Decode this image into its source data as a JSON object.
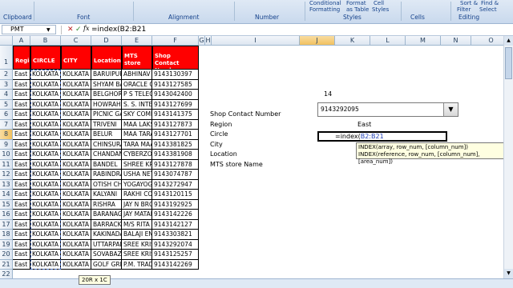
{
  "ribbon": {
    "top_labels": [
      "Formatting",
      "as Table",
      "Styles",
      "Filter",
      "Select"
    ],
    "top_label_extra": [
      "Conditional",
      "Format",
      "Cell",
      "Sort &",
      "Find &"
    ],
    "groups": [
      "Clipboard",
      "Font",
      "Alignment",
      "Number",
      "Styles",
      "Cells",
      "Editing"
    ]
  },
  "formula_bar": {
    "name_box": "PMT",
    "cancel_icon": "✕",
    "enter_icon": "✓",
    "fx_label": "fx",
    "formula": "=index(B2:B21"
  },
  "columns": [
    "A",
    "B",
    "C",
    "D",
    "E",
    "F",
    "G",
    "H",
    "I",
    "J",
    "K",
    "L",
    "M",
    "N",
    "O"
  ],
  "rows": [
    "1",
    "2",
    "3",
    "4",
    "5",
    "6",
    "7",
    "8",
    "9",
    "10",
    "11",
    "12",
    "13",
    "14",
    "15",
    "16",
    "17",
    "18",
    "19",
    "20",
    "21",
    "22"
  ],
  "table": {
    "headers": [
      "Region",
      "CIRCLE",
      "CITY",
      "Location",
      "MTS store name",
      "Shop Contact Number"
    ],
    "rows": [
      [
        "East",
        "KOLKATA",
        "KOLKATA SO",
        "BARUIPUR",
        "ABHINAV R",
        "9143130397"
      ],
      [
        "East",
        "KOLKATA",
        "KOLKATA CE",
        "SHYAM BAZ",
        "ORACLE CO",
        "9143127585"
      ],
      [
        "East",
        "KOLKATA",
        "KOLKATA NO",
        "BELGHORIA",
        "P S TELECO",
        "9143042400"
      ],
      [
        "East",
        "KOLKATA",
        "KOLKATA W",
        "HOWRAH",
        "S. S. INTER",
        "9143127699"
      ],
      [
        "East",
        "KOLKATA",
        "KOLKATA CE",
        "PICNIC GAR",
        "SKY COMM",
        "9143141375"
      ],
      [
        "East",
        "KOLKATA",
        "KOLKATA W",
        "TRIVENI",
        "MAA LAKSH",
        "9143127873"
      ],
      [
        "East",
        "KOLKATA",
        "KOLKATA W",
        "BELUR",
        "MAA TARA",
        "9143127701"
      ],
      [
        "East",
        "KOLKATA",
        "KOLKATA W",
        "CHINSURAH",
        "TARA MAA",
        "9143381825"
      ],
      [
        "East",
        "KOLKATA",
        "KOLKATA W",
        "CHANDANN",
        "CYBERZONE",
        "9143381908"
      ],
      [
        "East",
        "KOLKATA",
        "KOLKATA W",
        "BANDEL",
        "SHREE KRISH",
        "9143127878"
      ],
      [
        "East",
        "KOLKATA",
        "KOLKATA CE",
        "RABINDRA",
        "USHA NETCO",
        "9143074787"
      ],
      [
        "East",
        "KOLKATA",
        "KOLKATA SC",
        "OTISH CHA",
        "YOGAYOG",
        "9143272947"
      ],
      [
        "East",
        "KOLKATA",
        "KOLKATA NO",
        "KALYANI",
        "RAKHI COM",
        "9143120115"
      ],
      [
        "East",
        "KOLKATA",
        "KOLKATA W",
        "RISHRA",
        "JAY N BROT",
        "9143192925"
      ],
      [
        "East",
        "KOLKATA",
        "KOLKATA NO",
        "BARANAGAR",
        "JAY MATAD",
        "9143142226"
      ],
      [
        "East",
        "KOLKATA",
        "KOLKATA NO",
        "BARRACKPO",
        "M/S RITA TE",
        "9143142127"
      ],
      [
        "East",
        "KOLKATA",
        "KOLKATA NO",
        "KAKINADA",
        "BALAJI ENTE",
        "9143303821"
      ],
      [
        "East",
        "KOLKATA",
        "KOLKATA NO",
        "UTTARPARA",
        "SREE KRISH",
        "9143292074"
      ],
      [
        "East",
        "KOLKATA",
        "KOLKATA CE",
        "SOVABAZAR",
        "SREE KRISH",
        "9143125257"
      ],
      [
        "East",
        "KOLKATA",
        "KOLKATA SC",
        "GOLF GREE",
        "P.M. TRADI",
        "9143142269"
      ]
    ]
  },
  "right_panel": {
    "index_value": "14",
    "dropdown_value": "9143292095",
    "region_value": "East",
    "labels": [
      "Shop Contact Number",
      "Region",
      "Circle",
      "City",
      "Location",
      "MTS store Name"
    ],
    "edit_prefix": "=index(",
    "edit_ref": "B2:B21"
  },
  "tooltip": {
    "line1": "INDEX(array, row_num, [column_num])",
    "line2": "INDEX(reference, row_num, [column_num], [area_num])"
  },
  "size_indicator": "20R x 1C"
}
